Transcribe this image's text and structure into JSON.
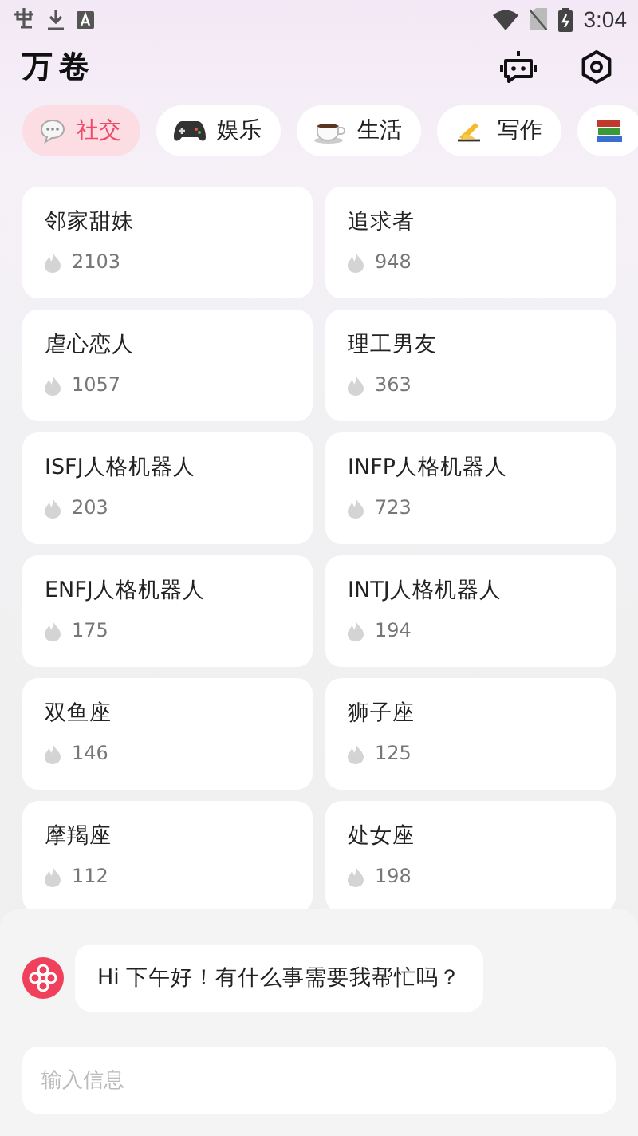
{
  "status_bar": {
    "time": "3:04"
  },
  "header": {
    "title": "万卷"
  },
  "tabs": [
    {
      "label": "社交",
      "kind": "chat",
      "selected": true
    },
    {
      "label": "娱乐",
      "kind": "gamepad",
      "selected": false
    },
    {
      "label": "生活",
      "kind": "coffee",
      "selected": false
    },
    {
      "label": "写作",
      "kind": "writing",
      "selected": false
    },
    {
      "kind": "books",
      "selected": false
    }
  ],
  "cards": [
    {
      "name": "邻家甜妹",
      "count": "2103"
    },
    {
      "name": "追求者",
      "count": "948"
    },
    {
      "name": "虐心恋人",
      "count": "1057"
    },
    {
      "name": "理工男友",
      "count": "363"
    },
    {
      "name": "ISFJ人格机器人",
      "count": "203"
    },
    {
      "name": "INFP人格机器人",
      "count": "723"
    },
    {
      "name": "ENFJ人格机器人",
      "count": "175"
    },
    {
      "name": "INTJ人格机器人",
      "count": "194"
    },
    {
      "name": "双鱼座",
      "count": "146"
    },
    {
      "name": "狮子座",
      "count": "125"
    },
    {
      "name": "摩羯座",
      "count": "112"
    },
    {
      "name": "处女座",
      "count": "198"
    }
  ],
  "chat": {
    "message": "Hi 下午好！有什么事需要我帮忙吗？",
    "input": {
      "placeholder": "输入信息"
    }
  }
}
